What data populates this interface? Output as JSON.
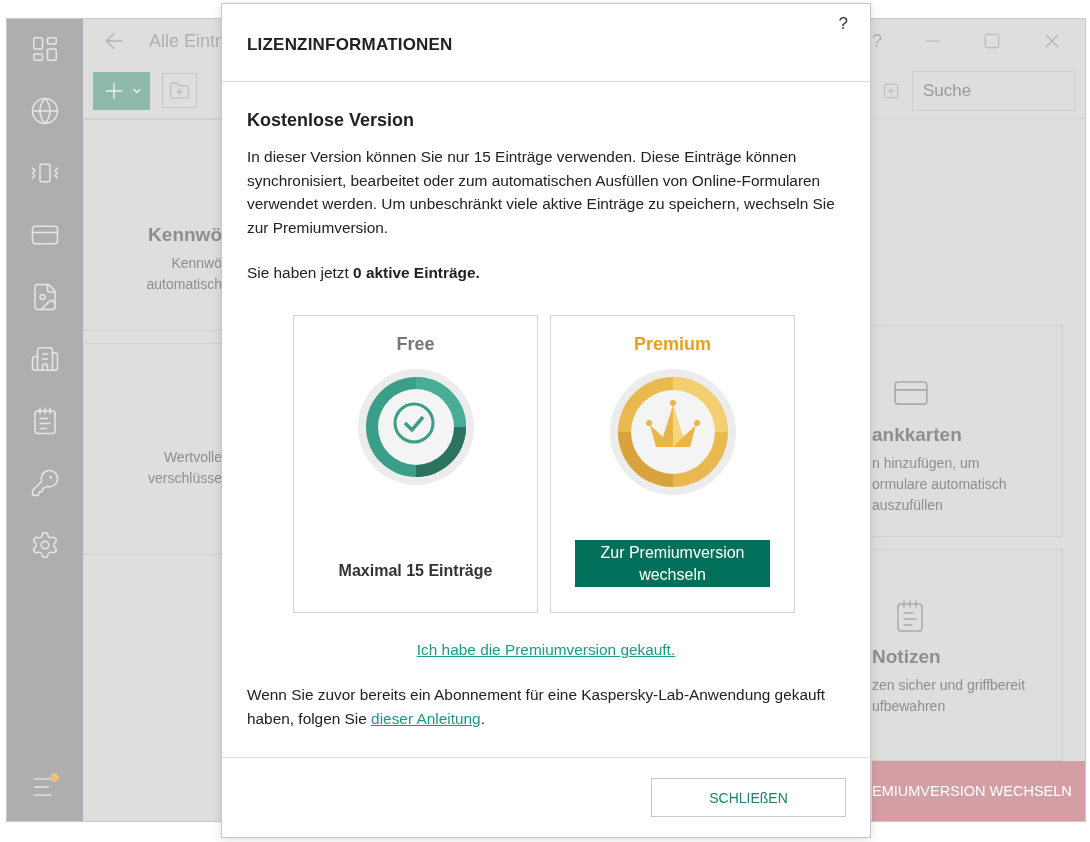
{
  "background_window": {
    "title": "Alle Eintr",
    "help": "?",
    "search": {
      "placeholder": "Suche"
    },
    "left_cards": [
      {
        "title": "Kennwö",
        "lines": [
          "Kennwö",
          "automatisch"
        ]
      },
      {
        "lines": [
          "Wertvolle",
          "verschlüsse"
        ]
      }
    ],
    "right_cards": [
      {
        "kind": "card",
        "title": "ankkarten",
        "lines": [
          "n hinzufügen, um",
          "ormulare automatisch",
          "auszufüllen"
        ]
      },
      {
        "kind": "notes",
        "title": "Notizen",
        "lines": [
          "zen sicher und griffbereit",
          "ufbewahren"
        ]
      }
    ],
    "upgrade_button": "EMIUMVERSION WECHSELN"
  },
  "dialog": {
    "title": "LIZENZINFORMATIONEN",
    "help": "?",
    "heading": "Kostenlose Version",
    "description": "In dieser Version können Sie nur 15 Einträge verwenden. Diese Einträge können synchronisiert, bearbeitet oder zum automatischen Ausfüllen von Online-Formularen verwendet werden. Um unbeschränkt viele aktive Einträge zu speichern, wechseln Sie zur Premiumversion.",
    "status": "Sie haben jetzt **0 aktive Einträge.**",
    "plans": [
      {
        "kind": "free",
        "name": "Free",
        "note": "Maximal 15 Einträge"
      },
      {
        "kind": "premium",
        "name": "Premium",
        "button": "Zur Premiumversion wechseln"
      }
    ],
    "purchased_link": "Ich habe die Premiumversion gekauft.",
    "footer_text": "Wenn Sie zuvor bereits ein Abonnement für eine Kaspersky-Lab-Anwendung gekauft haben, folgen Sie ",
    "footer_link": "dieser Anleitung",
    "footer_end": ".",
    "close_button": "SCHLIEßEN"
  }
}
